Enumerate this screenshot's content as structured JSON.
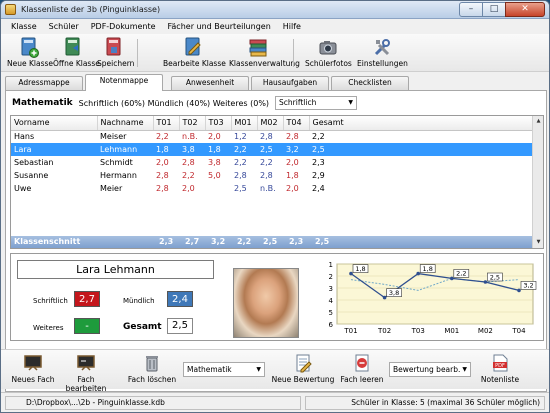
{
  "window": {
    "title": "Klassenliste der 3b (Pinguinklasse)",
    "min": "–",
    "max": "□",
    "close": "✕"
  },
  "menu": [
    "Klasse",
    "Schüler",
    "PDF-Dokumente",
    "Fächer und Beurteilungen",
    "Hilfe"
  ],
  "toolbar": {
    "new_class": "Neue Klasse",
    "open_class": "Öffne Klasse",
    "save": "Speichern",
    "edit_class": "Bearbeite Klasse",
    "class_admin": "Klassenverwaltung",
    "student_photos": "Schülerfotos",
    "settings": "Einstellungen"
  },
  "tabs": [
    "Adressmappe",
    "Notenmappe",
    "Anwesenheit",
    "Hausaufgaben",
    "Checklisten"
  ],
  "active_tab": "Notenmappe",
  "subject": {
    "name": "Mathematik",
    "weights": "Schriftlich (60%) Mündlich (40%) Weiteres (0%)",
    "weight_select": "Schriftlich"
  },
  "grid": {
    "headers": [
      "Vorname",
      "Nachname",
      "T01",
      "T02",
      "T03",
      "M01",
      "M02",
      "T04",
      "Gesamt"
    ],
    "rows": [
      {
        "vorname": "Hans",
        "nachname": "Meiser",
        "t01": "2,2",
        "t02": "n.B.",
        "t03": "2,0",
        "m01": "1,2",
        "m02": "2,8",
        "t04": "2,8",
        "gesamt": "2,2"
      },
      {
        "vorname": "Lara",
        "nachname": "Lehmann",
        "t01": "1,8",
        "t02": "3,8",
        "t03": "1,8",
        "m01": "2,2",
        "m02": "2,5",
        "t04": "3,2",
        "gesamt": "2,5"
      },
      {
        "vorname": "Sebastian",
        "nachname": "Schmidt",
        "t01": "2,0",
        "t02": "2,8",
        "t03": "3,8",
        "m01": "2,2",
        "m02": "2,2",
        "t04": "2,0",
        "gesamt": "2,3"
      },
      {
        "vorname": "Susanne",
        "nachname": "Hermann",
        "t01": "2,8",
        "t02": "2,2",
        "t03": "5,0",
        "m01": "2,8",
        "m02": "2,8",
        "t04": "1,8",
        "gesamt": "2,9"
      },
      {
        "vorname": "Uwe",
        "nachname": "Meier",
        "t01": "2,8",
        "t02": "2,0",
        "t03": "",
        "m01": "2,5",
        "m02": "n.B.",
        "t04": "2,0",
        "gesamt": "2,4"
      }
    ],
    "selected_row": 1,
    "class_average": {
      "label": "Klassenschnitt",
      "t01": "2,3",
      "t02": "2,7",
      "t03": "3,2",
      "m01": "2,2",
      "m02": "2,5",
      "t04": "2,3",
      "gesamt": "2,5"
    }
  },
  "student": {
    "full_name": "Lara Lehmann",
    "written_label": "Schriftlich",
    "written_grade": "2,7",
    "oral_label": "Mündlich",
    "oral_grade": "2,4",
    "other_label": "Weiteres",
    "other_grade": "-",
    "total_label": "Gesamt",
    "total_grade": "2,5"
  },
  "chart_data": {
    "type": "line",
    "categories": [
      "T01",
      "T02",
      "T03",
      "M01",
      "M02",
      "T04"
    ],
    "series": [
      {
        "values": [
          1.8,
          3.8,
          1.8,
          2.2,
          2.5,
          3.2
        ]
      },
      {
        "values": [
          2.3,
          2.7,
          3.2,
          2.2,
          2.5,
          2.3
        ]
      }
    ],
    "data_labels": [
      "1,8",
      "3,8",
      "1,8",
      "2,2",
      "2,5",
      "3,2"
    ],
    "y_ticks": [
      "1",
      "2",
      "3",
      "4",
      "5",
      "6"
    ],
    "ylim": [
      1,
      6
    ],
    "inverted_y": true,
    "colors": {
      "student": "#2f4f8f",
      "average": "#6fa8c8",
      "background": "#fbf7d6"
    }
  },
  "bottom": {
    "new_subject": "Neues Fach",
    "edit_subject": "Fach bearbeiten",
    "delete_subject": "Fach löschen",
    "subject_select": "Mathematik",
    "new_assessment": "Neue Bewertung",
    "clear_subject": "Fach leeren",
    "assessment_select": "Bewertung bearb.",
    "grade_list": "Notenliste"
  },
  "status": {
    "path": "D:\\Dropbox\\...\\2b - Pinguinklasse.kdb",
    "info": "Schüler in Klasse: 5 (maximal 36 Schüler möglich)"
  }
}
